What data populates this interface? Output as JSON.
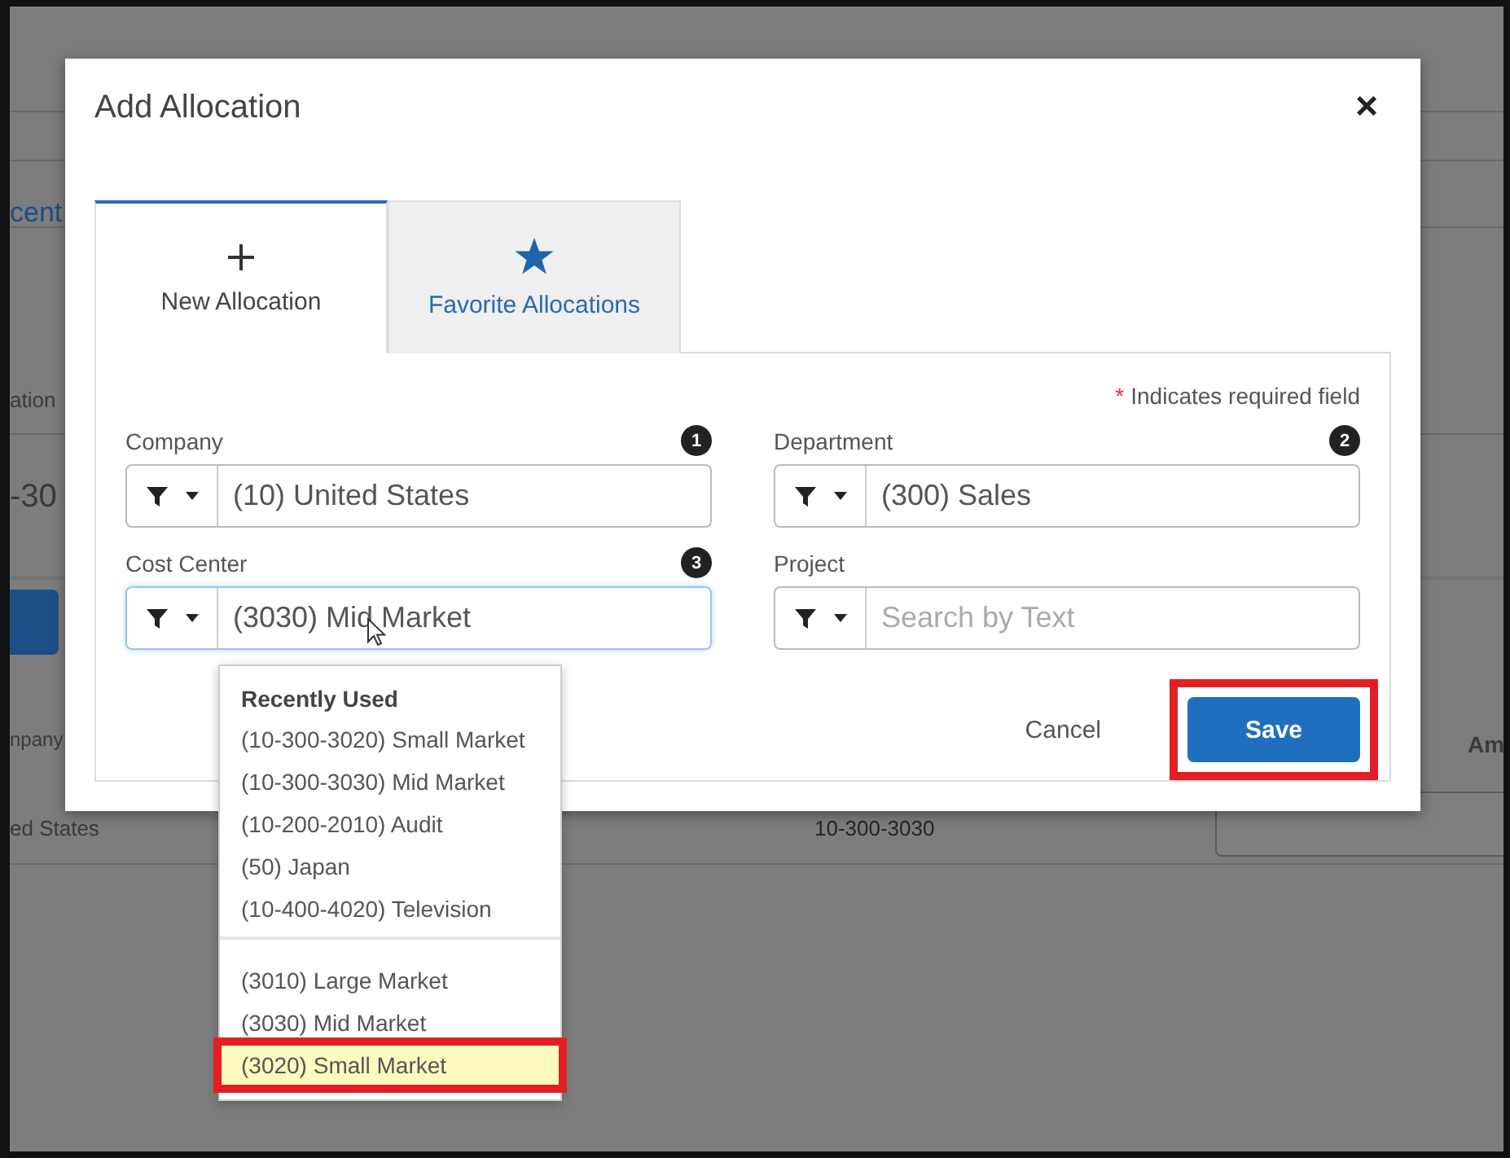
{
  "page_behind": {
    "link_fragment": "cent",
    "label_fragment": "ation",
    "value_fragment": "-30",
    "column_fragment": "npany",
    "cell_fragment": "ed States",
    "cell_code": "10-300-3030",
    "column_fragment_2": "Am"
  },
  "dialog": {
    "title": "Add Allocation",
    "close": "×",
    "tabs": [
      {
        "label": "New Allocation",
        "selected": true
      },
      {
        "label": "Favorite Allocations",
        "selected": false
      }
    ],
    "required_note": {
      "mark": "*",
      "text": "Indicates required field"
    },
    "fields": [
      {
        "label": "Company",
        "badge": "1",
        "value": "(10) United States",
        "focused": false
      },
      {
        "label": "Department",
        "badge": "2",
        "value": "(300) Sales",
        "focused": false
      },
      {
        "label": "Cost Center",
        "badge": "3",
        "value": "(3030) Mid Market",
        "focused": true
      },
      {
        "label": "Project",
        "placeholder": "Search by Text",
        "focused": false
      }
    ],
    "buttons": [
      {
        "kind": "link",
        "label": "Cancel",
        "annotated": false
      },
      {
        "kind": "primary",
        "label": "Save",
        "annotated": true
      }
    ]
  },
  "dropdown": {
    "sections": [
      {
        "heading": "Recently Used",
        "items": [
          {
            "label": "(10-300-3020) Small Market",
            "selected": false,
            "annotated": false
          },
          {
            "label": "(10-300-3030) Mid Market",
            "selected": false,
            "annotated": false
          },
          {
            "label": "(10-200-2010) Audit",
            "selected": false,
            "annotated": false
          },
          {
            "label": "(50) Japan",
            "selected": false,
            "annotated": false
          },
          {
            "label": "(10-400-4020) Television",
            "selected": false,
            "annotated": false
          }
        ]
      },
      {
        "items": [
          {
            "label": "(3010) Large Market",
            "selected": false,
            "annotated": false
          },
          {
            "label": "(3030) Mid Market",
            "selected": false,
            "annotated": false
          },
          {
            "label": "(3020) Small Market",
            "selected": true,
            "annotated": true
          }
        ]
      }
    ]
  }
}
